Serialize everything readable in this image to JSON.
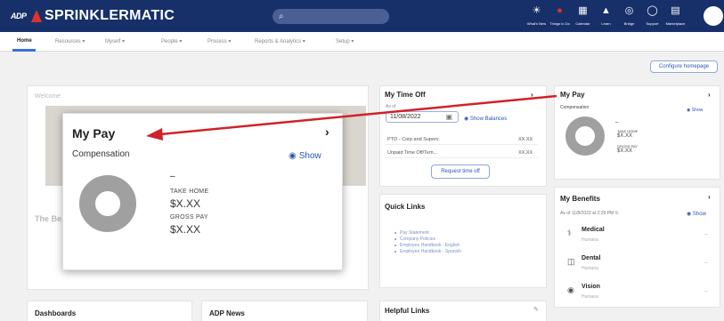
{
  "header": {
    "logo": "ADP",
    "brand": "SPRINKLERMATIC",
    "top_icons": [
      {
        "icon": "lightbulb-icon",
        "glyph": "☀",
        "label": "What's New"
      },
      {
        "icon": "todo-icon",
        "glyph": "●",
        "label": "Things to Do"
      },
      {
        "icon": "calendar-icon",
        "glyph": "▦",
        "label": "Calendar"
      },
      {
        "icon": "learn-icon",
        "glyph": "▲",
        "label": "Learn"
      },
      {
        "icon": "bridge-icon",
        "glyph": "◎",
        "label": "Bridge"
      },
      {
        "icon": "support-icon",
        "glyph": "◯",
        "label": "Support"
      },
      {
        "icon": "marketplace-icon",
        "glyph": "▤",
        "label": "Marketplace"
      }
    ]
  },
  "nav": {
    "home": "Home",
    "resources": "Resources ▾",
    "myself": "Myself ▾",
    "people": "People ▾",
    "process": "Process ▾",
    "reports": "Reports & Analytics ▾",
    "setup": "Setup ▾"
  },
  "configure_label": "Configure homepage",
  "welcome": {
    "title": "Welcome",
    "greeting": "The Be"
  },
  "time_off": {
    "title": "My Time Off",
    "chevron": "›",
    "as_of_label": "As of",
    "date": "11/08/2022",
    "show_balances": "Show Balances",
    "rows": [
      {
        "name": "PTO - Corp and Superv.",
        "value": "XX.XX"
      },
      {
        "name": "Unpaid Time Off/Tem...",
        "value": "XX.XX"
      }
    ],
    "request_button": "Request time off"
  },
  "quick_links": {
    "title": "Quick Links",
    "items": [
      "Pay Statement",
      "Company Policies",
      "Employee Handbook - English",
      "Employee Handbook - Spanish"
    ]
  },
  "helpful_links": {
    "title": "Helpful Links"
  },
  "dashboards": {
    "title": "Dashboards"
  },
  "adp_news": {
    "title": "ADP News"
  },
  "my_pay_small": {
    "title": "My Pay",
    "chevron": "›",
    "subtitle": "Compensation",
    "show": "Show",
    "dash": "–",
    "take_home_label": "TAKE HOME",
    "take_home_value": "$X.XX",
    "gross_pay_label": "GROSS PAY",
    "gross_pay_value": "$X.XX"
  },
  "benefits": {
    "title": "My Benefits",
    "chevron": "›",
    "as_of": "As of 11/8/2022 at 2:29 PM",
    "show": "Show",
    "items": [
      {
        "name": "Medical",
        "sub": "Humana",
        "value": "--"
      },
      {
        "name": "Dental",
        "sub": "Humana",
        "value": "--"
      },
      {
        "name": "Vision",
        "sub": "Humana",
        "value": "--"
      }
    ]
  },
  "my_pay_popup": {
    "title": "My Pay",
    "chevron": "›",
    "subtitle": "Compensation",
    "show": "Show",
    "dash": "–",
    "take_home_label": "TAKE HOME",
    "take_home_value": "$X.XX",
    "gross_pay_label": "GROSS PAY",
    "gross_pay_value": "$X.XX"
  },
  "colors": {
    "header_bg": "#17306a",
    "accent_blue": "#2b56b3",
    "annotation_arrow": "#d0222a",
    "donut_gray": "#a0a0a0"
  }
}
